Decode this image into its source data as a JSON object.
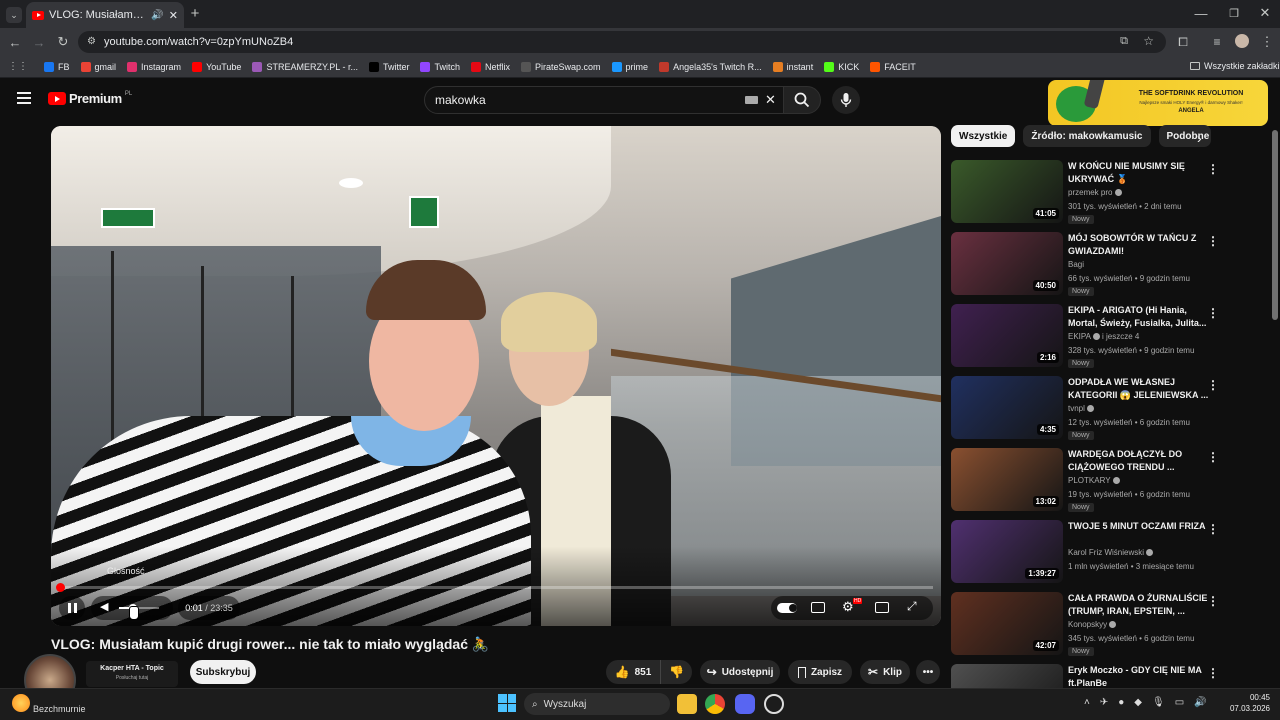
{
  "browser": {
    "tab_title": "VLOG: Musiałam kupić drugi rower",
    "url": "youtube.com/watch?v=0zpYmUNoZB4",
    "bookmarks": [
      {
        "label": "FB",
        "color": "#1877f2"
      },
      {
        "label": "gmail",
        "color": "#ea4335"
      },
      {
        "label": "Instagram",
        "color": "#e1306c"
      },
      {
        "label": "YouTube",
        "color": "#ff0000"
      },
      {
        "label": "STREAMERZY.PL - r...",
        "color": "#9b59b6"
      },
      {
        "label": "Twitter",
        "color": "#000000"
      },
      {
        "label": "Twitch",
        "color": "#9146ff"
      },
      {
        "label": "Netflix",
        "color": "#e50914"
      },
      {
        "label": "PirateSwap.com",
        "color": "#555555"
      },
      {
        "label": "prime",
        "color": "#1a98ff"
      },
      {
        "label": "Angela35's Twitch R...",
        "color": "#c0392b"
      },
      {
        "label": "instant",
        "color": "#e67e22"
      },
      {
        "label": "KICK",
        "color": "#53fc18"
      },
      {
        "label": "FACEIT",
        "color": "#ff5500"
      }
    ],
    "all_bookmarks": "Wszystkie zakładki"
  },
  "youtube": {
    "logo": "Premium",
    "logo_region": "PL",
    "search_value": "makowka",
    "ad_banner": {
      "title": "THE SOFTDRINK REVOLUTION",
      "subtitle": "Najlepsze smaki HOLY Energy® i darmowy Shaker!",
      "name": "ANGELA"
    },
    "video": {
      "title": "VLOG: Musiałam kupić drugi rower... nie tak to miało wyglądać 🚴",
      "time_current": "0:01",
      "time_sep": " / ",
      "time_total": "23:35",
      "volume_tooltip": "Głośność",
      "progress": 0.001
    },
    "channel": {
      "name": "Kacper HTA - Topic",
      "sub_text": "Posłuchaj tutaj",
      "subscribe": "Subskrybuj",
      "status": "Bezchmurnie"
    },
    "actions": {
      "likes": "851",
      "share": "Udostępnij",
      "save": "Zapisz",
      "clip": "Klip"
    },
    "chips": [
      "Wszystkie",
      "Źródło: makowkamusic",
      "Podobne"
    ],
    "recommendations": [
      {
        "title": "W KOŃCU NIE MUSIMY SIĘ UKRYWAĆ 🥉",
        "channel": "przemek pro",
        "verified": true,
        "meta": "301 tys. wyświetleń • 2 dni temu",
        "badge": "Nowy",
        "duration": "41:05",
        "bg": "#3a5a2a"
      },
      {
        "title": "MÓJ SOBOWTÓR W TAŃCU Z GWIAZDAMI!",
        "channel": "Bagi",
        "verified": false,
        "meta": "66 tys. wyświetleń • 9 godzin temu",
        "badge": "Nowy",
        "duration": "40:50",
        "bg": "#6a3040"
      },
      {
        "title": "EKIPA - ARIGATO (Hi Hania, Mortal, Świeży, Fusialka, Julita...",
        "channel": "EKIPA",
        "verified": true,
        "channel_extra": "i jeszcze 4",
        "meta": "328 tys. wyświetleń • 9 godzin temu",
        "badge": "Nowy",
        "duration": "2:16",
        "bg": "#402050"
      },
      {
        "title": "ODPADŁA WE WŁASNEJ KATEGORII 😱 JELENIEWSKA ...",
        "channel": "tvnpl",
        "verified": true,
        "meta": "12 tys. wyświetleń • 6 godzin temu",
        "badge": "Nowy",
        "duration": "4:35",
        "bg": "#203060"
      },
      {
        "title": "WARDĘGA DOŁĄCZYŁ DO CIĄŻOWEGO TRENDU ...",
        "channel": "PLOTKARY",
        "verified": true,
        "meta": "19 tys. wyświetleń • 6 godzin temu",
        "badge": "Nowy",
        "duration": "13:02",
        "bg": "#8a5030"
      },
      {
        "title": "TWOJE 5 MINUT OCZAMI FRIZA",
        "channel": "Karol Friz Wiśniewski",
        "verified": true,
        "meta": "1 mln wyświetleń • 3 miesiące temu",
        "badge": "",
        "duration": "1:39:27",
        "bg": "#503070"
      },
      {
        "title": "CAŁA PRAWDA O ŻURNALIŚCIE (TRUMP, IRAN, EPSTEIN, ...",
        "channel": "Konopskyy",
        "verified": true,
        "meta": "345 tys. wyświetleń • 6 godzin temu",
        "badge": "Nowy",
        "duration": "42:07",
        "bg": "#603020"
      },
      {
        "title": "Eryk Moczko - GDY CIĘ NIE MA ft.PlanBe",
        "channel": "",
        "verified": false,
        "meta": "",
        "badge": "",
        "duration": "",
        "bg": "#505050"
      }
    ]
  },
  "taskbar": {
    "search": "Wyszukaj",
    "time": "00:45",
    "date": "07.03.2026"
  }
}
